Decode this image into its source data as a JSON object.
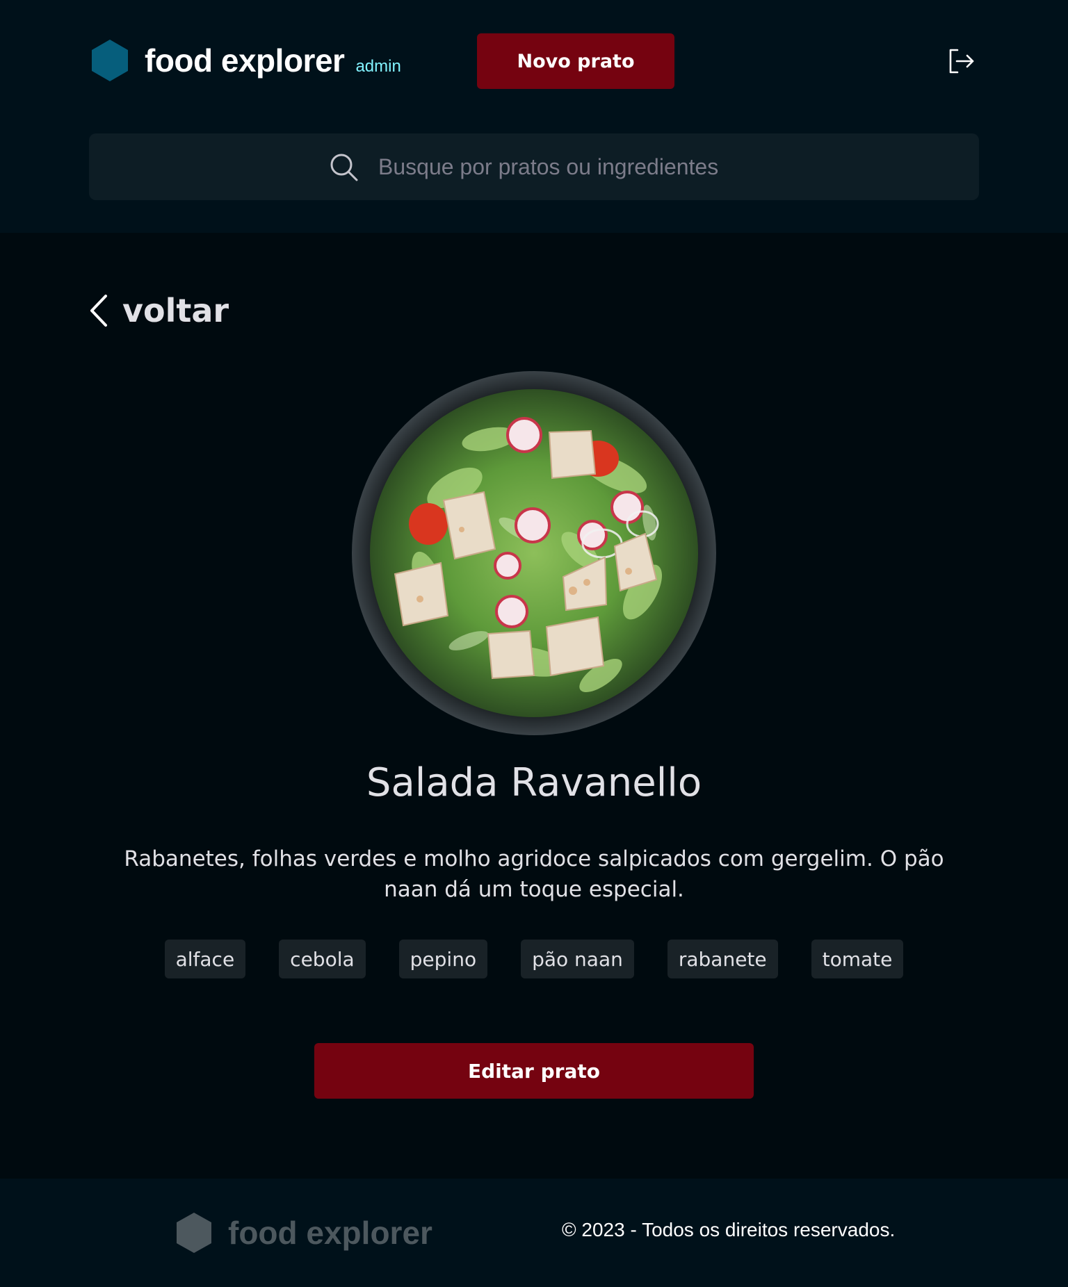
{
  "header": {
    "brand_name": "food explorer",
    "brand_badge": "admin",
    "new_dish_label": "Novo prato",
    "logout_icon": "logout-icon"
  },
  "search": {
    "placeholder": "Busque por pratos ou ingredientes",
    "icon": "search-icon"
  },
  "back": {
    "label": "voltar",
    "icon": "chevron-left-icon"
  },
  "dish": {
    "image_icon": "salad-bowl-image",
    "title": "Salada Ravanello",
    "description": "Rabanetes, folhas verdes e molho agridoce salpicados com gergelim. O pão naan dá um toque especial.",
    "ingredients": [
      "alface",
      "cebola",
      "pepino",
      "pão naan",
      "rabanete",
      "tomate"
    ],
    "edit_label": "Editar prato"
  },
  "footer": {
    "brand_name": "food explorer",
    "copyright": "© 2023 - Todos os direitos reservados."
  },
  "colors": {
    "page_bg": "#000A0F",
    "header_bg": "#00111A",
    "accent_red": "#750310",
    "brand_hex": "#065E7C",
    "badge_cyan": "#82F3FF",
    "tag_bg": "#192227",
    "search_bg": "#0D1D25"
  }
}
